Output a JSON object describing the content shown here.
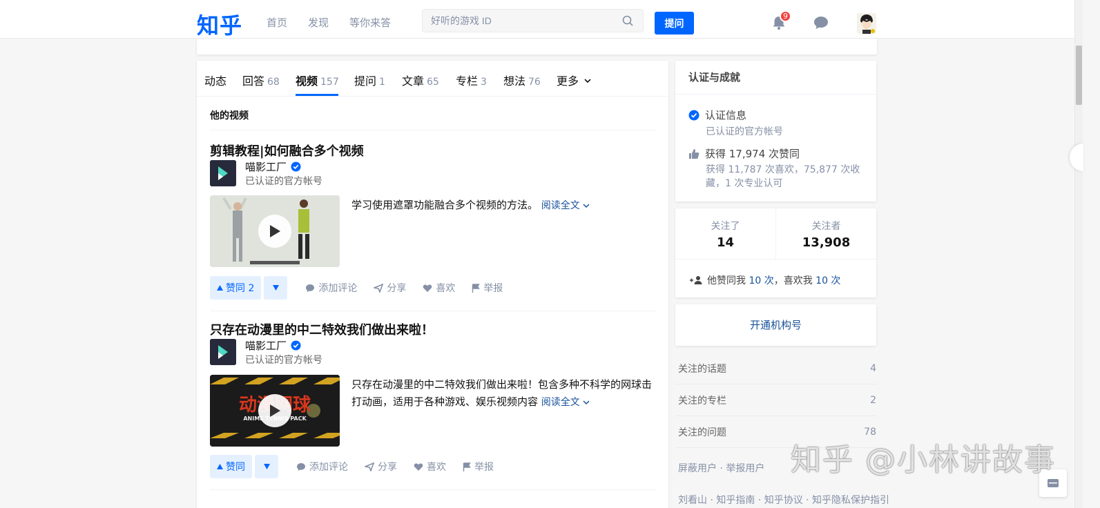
{
  "header": {
    "logo": "知乎",
    "nav": [
      "首页",
      "发现",
      "等你来答"
    ],
    "search_placeholder": "好听的游戏 ID",
    "ask_label": "提问",
    "notification_count": "9"
  },
  "tabs": [
    {
      "label": "动态",
      "count": ""
    },
    {
      "label": "回答",
      "count": "68"
    },
    {
      "label": "视频",
      "count": "157"
    },
    {
      "label": "提问",
      "count": "1"
    },
    {
      "label": "文章",
      "count": "65"
    },
    {
      "label": "专栏",
      "count": "3"
    },
    {
      "label": "想法",
      "count": "76"
    },
    {
      "label": "更多",
      "count": ""
    }
  ],
  "active_tab": "视频",
  "section_title": "他的视频",
  "items": [
    {
      "title": "剪辑教程|如何融合多个视频",
      "author": "喵影工厂",
      "author_desc": "已认证的官方帐号",
      "excerpt": "学习使用遮罩功能融合多个视频的方法。",
      "read_more": "阅读全文",
      "vote_label": "赞同 2",
      "actions": [
        "添加评论",
        "分享",
        "喜欢",
        "举报"
      ]
    },
    {
      "title": "只存在动漫里的中二特效我们做出来啦！",
      "author": "喵影工厂",
      "author_desc": "已认证的官方帐号",
      "excerpt": "只存在动漫里的中二特效我们做出来啦！包含多种不科学的网球击打动画，适用于各种游戏、娱乐视频内容",
      "read_more": "阅读全文",
      "vote_label": "赞同",
      "thumb_text": "动漫网球",
      "thumb_sub": "ANIME TENNIS PACK",
      "actions": [
        "添加评论",
        "分享",
        "喜欢",
        "举报"
      ]
    }
  ],
  "achievements": {
    "title": "认证与成就",
    "verified_label": "认证信息",
    "verified_sub": "已认证的官方帐号",
    "likes_label": "获得 17,974 次赞同",
    "likes_sub": "获得 11,787 次喜欢，75,877 次收藏，1 次专业认可"
  },
  "follow": {
    "following_label": "关注了",
    "following_count": "14",
    "followers_label": "关注者",
    "followers_count": "13,908",
    "extra_prefix": "他赞同我",
    "extra_n1": "10 次",
    "extra_mid": "，喜欢我",
    "extra_n2": "10 次"
  },
  "open_org": "开通机构号",
  "side_list": [
    {
      "label": "关注的话题",
      "count": "4"
    },
    {
      "label": "关注的专栏",
      "count": "2"
    },
    {
      "label": "关注的问题",
      "count": "78"
    }
  ],
  "block_links": "屏蔽用户 · 举报用户",
  "footer_links": "刘看山 · 知乎指南 · 知乎协议 · 知乎隐私保护指引",
  "watermark": "知乎 @小林讲故事",
  "colors": {
    "brand": "#0066ff",
    "link": "#175199",
    "badge": "#f1403c"
  }
}
